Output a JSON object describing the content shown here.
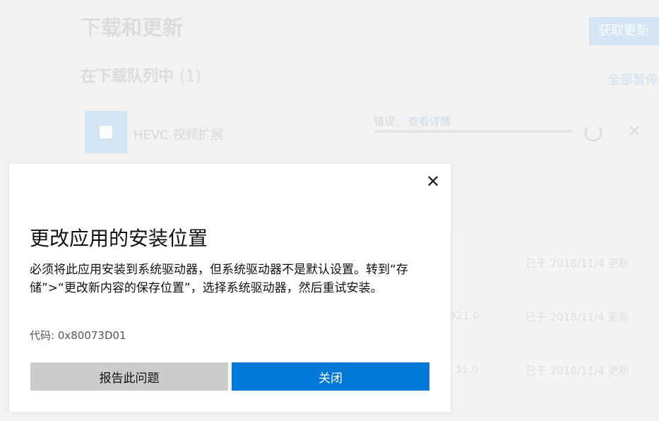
{
  "background": {
    "page_title": "下载和更新",
    "get_updates_button": "获取更新",
    "queue_heading": "在下载队列中",
    "queue_count": "(1)",
    "pause_all_link": "全部暂停",
    "queue_item": {
      "app_name": "HEVC 视频扩展",
      "error_label": "错误:",
      "error_link": "查看详情",
      "retry_icon": "refresh-icon",
      "dismiss_icon": "close-icon"
    },
    "recent_rows": [
      {
        "version": "",
        "date": "已于 2018/11/4 更新"
      },
      {
        "version": "921.0",
        "date": "已于 2018/11/4 更新"
      },
      {
        "version": "31.0",
        "date": "已于 2018/11/4 更新"
      }
    ]
  },
  "dialog": {
    "title": "更改应用的安装位置",
    "message": "必须将此应用安装到系统驱动器，但系统驱动器不是默认设置。转到“存储”>“更改新内容的保存位置”，选择系统驱动器，然后重试安装。",
    "code": "代码: 0x80073D01",
    "report_button": "报告此问题",
    "close_button": "关闭",
    "close_icon": "close-icon"
  },
  "colors": {
    "accent": "#0078d7",
    "secondary_button": "#cccccc"
  }
}
